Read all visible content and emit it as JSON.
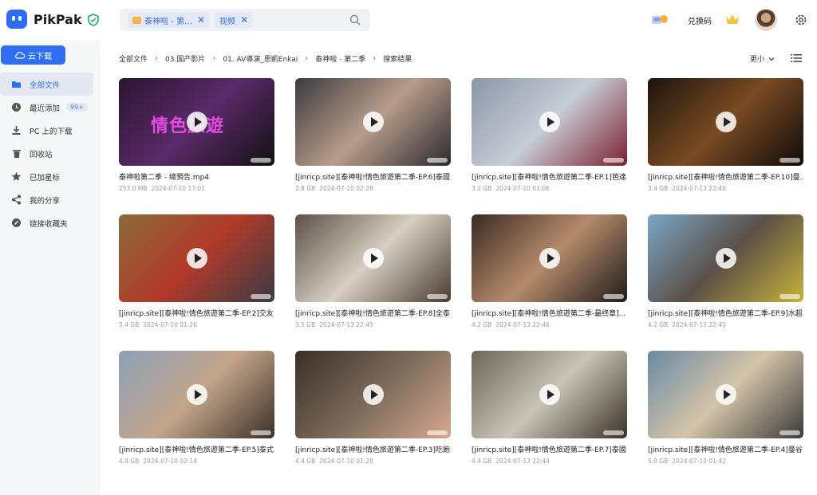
{
  "brand": {
    "name": "PikPak"
  },
  "search": {
    "chips": [
      {
        "label": "泰神啦 - 第…",
        "type": "folder"
      },
      {
        "label": "视频",
        "type": "filter"
      }
    ]
  },
  "header": {
    "redeem_label": "兑换码"
  },
  "sidebar": {
    "cloud_download_label": "云下载",
    "items": [
      {
        "label": "全部文件",
        "icon": "folder-icon",
        "active": true
      },
      {
        "label": "最近添加",
        "icon": "clock-icon",
        "badge": "99+"
      },
      {
        "label": "PC 上的下载",
        "icon": "download-icon"
      },
      {
        "label": "回收站",
        "icon": "trash-icon"
      },
      {
        "label": "已加星标",
        "icon": "star-icon"
      },
      {
        "label": "我的分享",
        "icon": "share-icon"
      },
      {
        "label": "链接收藏夹",
        "icon": "link-icon"
      }
    ]
  },
  "breadcrumb": [
    "全部文件",
    "03.国产影片",
    "01. AV導演_恩凱Enkai",
    "泰神啦 - 第二季",
    "搜索结果"
  ],
  "toolbar": {
    "sort_label": "更小"
  },
  "files": [
    {
      "name": "泰神啦第二季 - 總預告.mp4",
      "size": "257.0 MB",
      "date": "2024-07-10 17:01",
      "overlay": "情色旅遊",
      "colors": [
        "#2a1530",
        "#5b2a6a",
        "#111"
      ]
    },
    {
      "name": "[jinricp.site][泰神啦!情色旅遊第二季-EP.6]泰國...",
      "size": "2.8 GB",
      "date": "2024-07-10 02:28",
      "colors": [
        "#3b3a3f",
        "#b89c8a",
        "#2a2a30"
      ]
    },
    {
      "name": "[jinricp.site][泰神啦!情色旅遊第二季-EP.1]芭達...",
      "size": "3.2 GB",
      "date": "2024-07-10 01:06",
      "colors": [
        "#8a96a8",
        "#c7cdd6",
        "#7a1f2f"
      ]
    },
    {
      "name": "[jinricp.site][泰神啦!情色旅遊第二季-EP.10]曼...",
      "size": "3.4 GB",
      "date": "2024-07-13 22:46",
      "colors": [
        "#1a1410",
        "#7a4a22",
        "#0d0b09"
      ]
    },
    {
      "name": "[jinricp.site][泰神啦!情色旅遊第二季-EP.2]交友...",
      "size": "3.4 GB",
      "date": "2024-07-10 01:26",
      "colors": [
        "#8a6a3a",
        "#b23a2a",
        "#3a3a44"
      ]
    },
    {
      "name": "[jinricp.site][泰神啦!情色旅遊第二季-EP.8]全泰...",
      "size": "3.5 GB",
      "date": "2024-07-13 22:45",
      "colors": [
        "#5a5048",
        "#d6cfc3",
        "#4a3b30"
      ]
    },
    {
      "name": "[jinricp.site][泰神啦!情色旅遊第二季-最终章]...",
      "size": "4.2 GB",
      "date": "2024-07-13 22:46",
      "colors": [
        "#3a2a22",
        "#b58b6c",
        "#1f1c1a"
      ]
    },
    {
      "name": "[jinricp.site][泰神啦!情色旅遊第二季-EP.9]水超...",
      "size": "4.2 GB",
      "date": "2024-07-13 22:45",
      "colors": [
        "#7aa6c8",
        "#5a5048",
        "#c8b23a"
      ]
    },
    {
      "name": "[jinricp.site][泰神啦!情色旅遊第二季-EP.5]泰式...",
      "size": "4.4 GB",
      "date": "2024-07-10 02:14",
      "colors": [
        "#8aa0b8",
        "#c4a58a",
        "#3a3028"
      ]
    },
    {
      "name": "[jinricp.site][泰神啦!情色旅遊第二季-EP.3]吃飽...",
      "size": "4.4 GB",
      "date": "2024-07-10 01:28",
      "colors": [
        "#3a2e26",
        "#7a6a5a",
        "#d8a890"
      ]
    },
    {
      "name": "[jinricp.site][泰神啦!情色旅遊第二季-EP.7]泰國...",
      "size": "4.4 GB",
      "date": "2024-07-13 22:44",
      "colors": [
        "#6a6658",
        "#c8c4b8",
        "#3a3228"
      ]
    },
    {
      "name": "[jinricp.site][泰神啦!情色旅遊第二季-EP.4]曼谷...",
      "size": "5.0 GB",
      "date": "2024-07-10 01:42",
      "colors": [
        "#6a8aa4",
        "#d4c4a8",
        "#3a3a3a"
      ]
    }
  ],
  "accent_color": "#2f6ef3"
}
